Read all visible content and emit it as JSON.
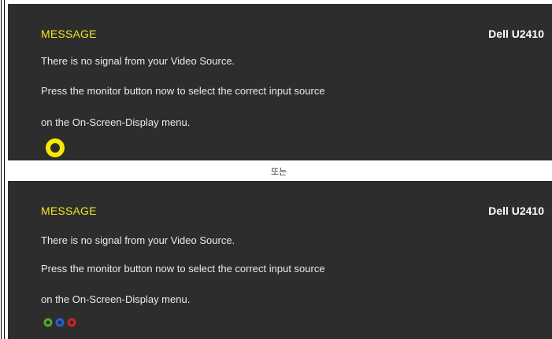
{
  "panels": [
    {
      "title": "MESSAGE",
      "model": "Dell U2410",
      "lines": [
        "There is no signal  from your Video Source.",
        "Press the monitor button now to select the correct input source",
        "on the On-Screen-Display menu."
      ],
      "icon": "yellow-ring-icon"
    },
    {
      "title": "MESSAGE",
      "model": "Dell U2410",
      "lines": [
        "There is no signal  from your Video Source.",
        "Press the monitor button now to select the correct input source",
        "on the On-Screen-Display menu."
      ],
      "icon": "rgb-dots-icon"
    }
  ],
  "separator": "또는",
  "colors": {
    "panel_bg": "#2d2d2d",
    "title": "#f2e51f",
    "ring_yellow": "#f5ea00",
    "dot_green": "#4caf24",
    "dot_blue": "#1e63d6",
    "dot_red": "#d32222"
  }
}
